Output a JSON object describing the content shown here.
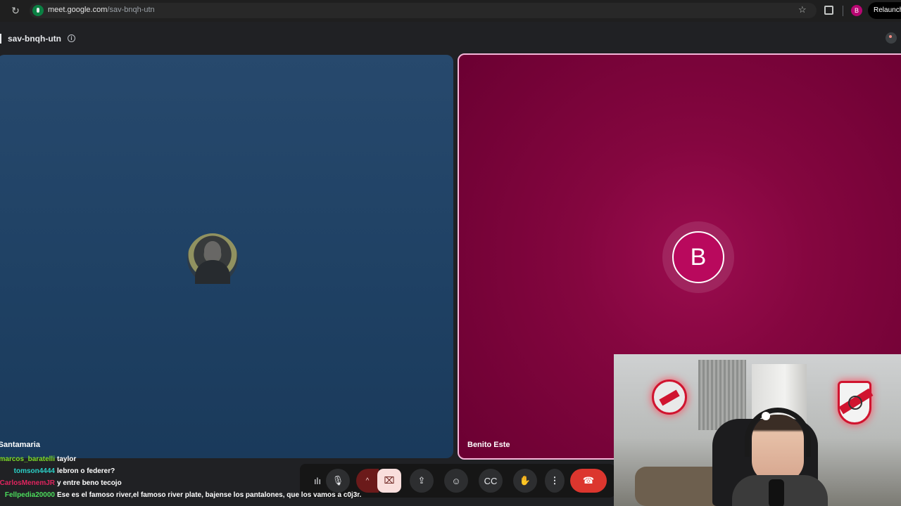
{
  "browser": {
    "url_domain": "meet.google.com",
    "url_path": "/sav-bnqh-utn",
    "profile_initial": "B",
    "relaunch_label": "Relaunch t"
  },
  "meeting": {
    "code": "sav-bnqh-utn",
    "info_glyph": "i"
  },
  "participants": [
    {
      "name": "Emiliano Santamaria",
      "visible_name": "iano Santamaria",
      "tile_color": "#1f4164"
    },
    {
      "name": "Benito Este",
      "initial": "B",
      "tile_color": "#84063f",
      "speaking": true
    }
  ],
  "toolbar": {
    "wave_glyph": "ılı",
    "mic_glyph": "🎙",
    "arrow_glyph": "^",
    "camera_glyph": "⌧",
    "present_glyph": "⇪",
    "emoji_glyph": "☺",
    "captions_glyph": "CC",
    "hand_glyph": "✋",
    "more_glyph": "⋮",
    "end_glyph": "☎"
  },
  "chat": [
    {
      "user": "marcos_baratelli",
      "text": "taylor",
      "color": "#7ddc2a"
    },
    {
      "user": "tomson4444",
      "text": "lebron o federer?",
      "color": "#2bd0c7"
    },
    {
      "user": "CarlosMenemJR",
      "text": "y entre beno tecojo",
      "color": "#e0245e"
    },
    {
      "user": "Fellpedia20000",
      "text": "Ese es el famoso river,el famoso river plate, bajense los pantalones, que los vamos a c0j3r.",
      "color": "#4cdc5c"
    }
  ],
  "colors": {
    "accent_pink": "#f5b6d9",
    "end_call_red": "#dc362e"
  }
}
